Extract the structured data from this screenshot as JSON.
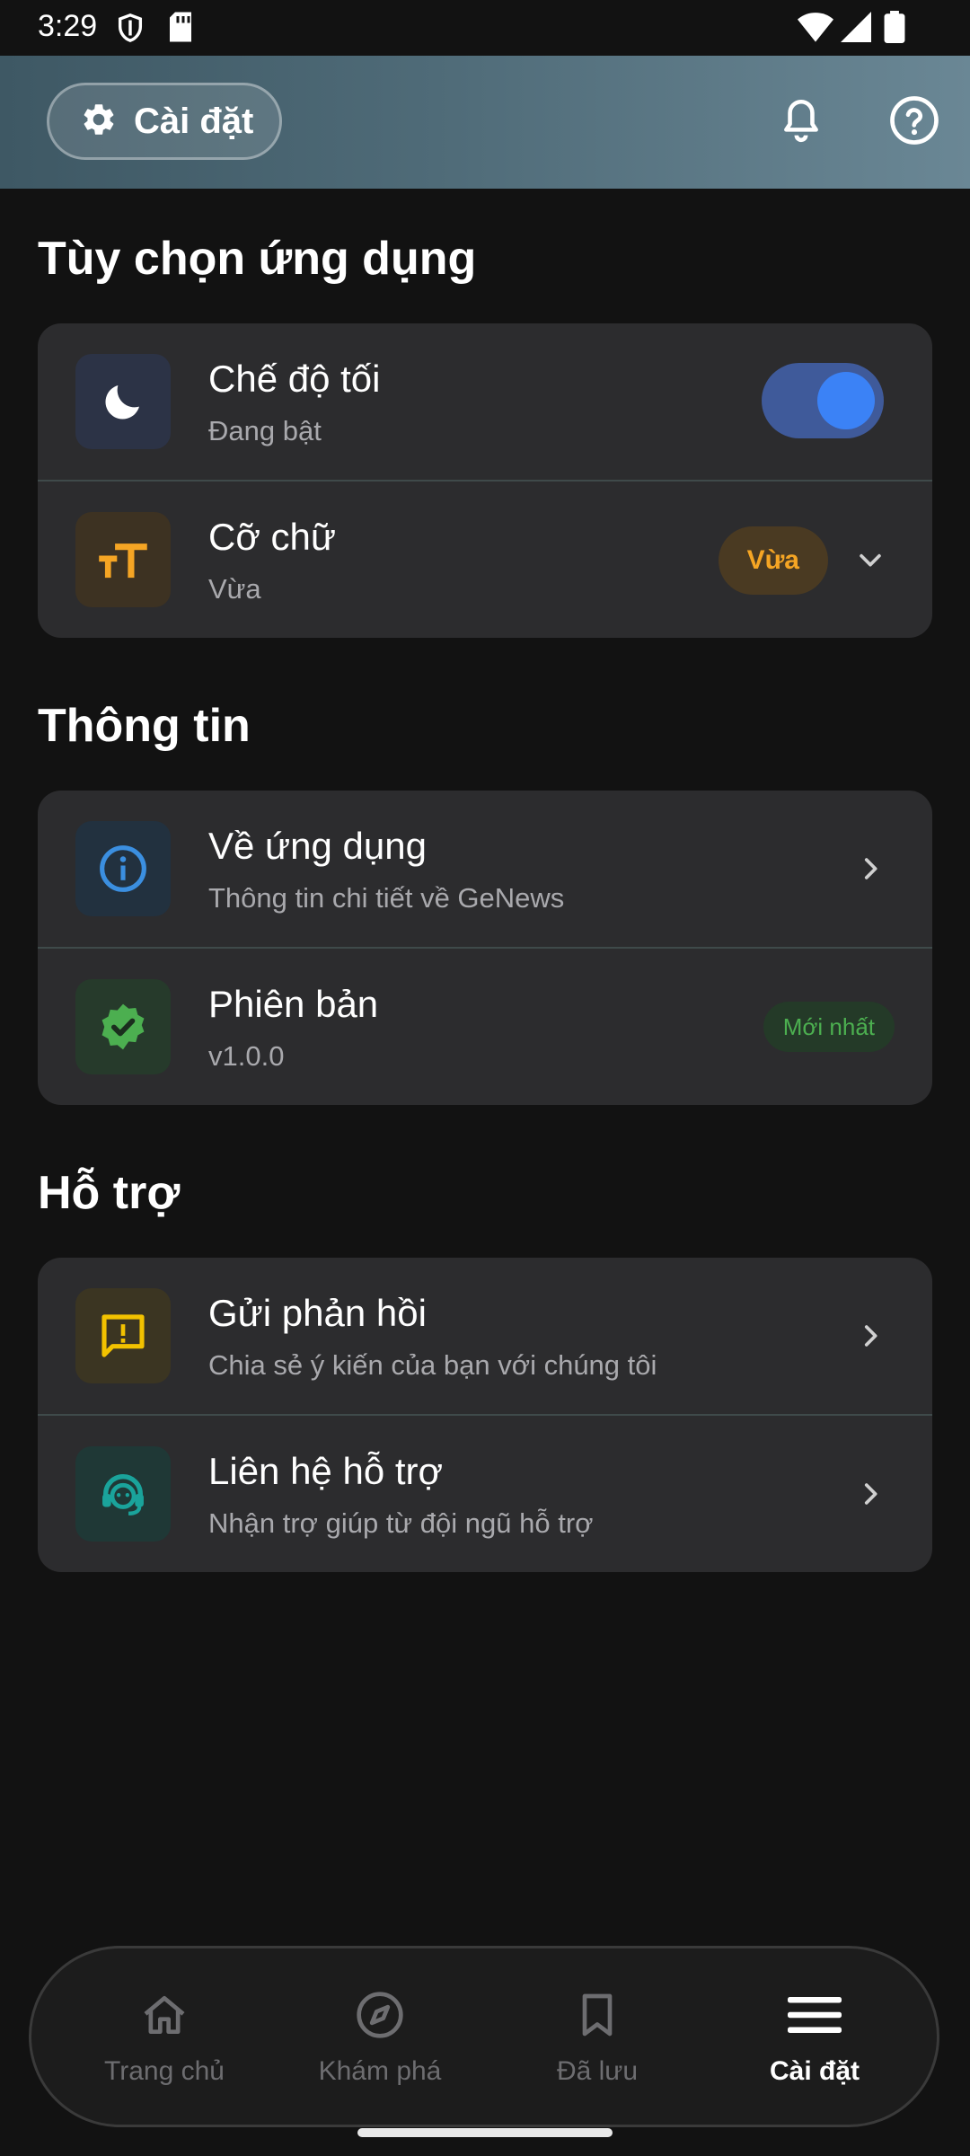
{
  "status_bar": {
    "time": "3:29"
  },
  "header": {
    "settings_label": "Cài đặt"
  },
  "sections": [
    {
      "title": "Tùy chọn ứng dụng",
      "items": [
        {
          "title": "Chế độ tối",
          "subtitle": "Đang bật",
          "icon": "moon-icon",
          "toggle_on": true
        },
        {
          "title": "Cỡ chữ",
          "subtitle": "Vừa",
          "icon": "text-size-icon",
          "badge": "Vừa"
        }
      ]
    },
    {
      "title": "Thông tin",
      "items": [
        {
          "title": "Về ứng dụng",
          "subtitle": "Thông tin chi tiết về GeNews",
          "icon": "info-icon"
        },
        {
          "title": "Phiên bản",
          "subtitle": "v1.0.0",
          "icon": "verified-icon",
          "badge": "Mới nhất"
        }
      ]
    },
    {
      "title": "Hỗ trợ",
      "items": [
        {
          "title": "Gửi phản hồi",
          "subtitle": "Chia sẻ ý kiến của bạn với chúng tôi",
          "icon": "feedback-icon"
        },
        {
          "title": "Liên hệ hỗ trợ",
          "subtitle": "Nhận trợ giúp từ đội ngũ hỗ trợ",
          "icon": "support-agent-icon"
        }
      ]
    }
  ],
  "bottom_nav": [
    {
      "label": "Trang chủ",
      "icon": "home-icon",
      "active": false
    },
    {
      "label": "Khám phá",
      "icon": "compass-icon",
      "active": false
    },
    {
      "label": "Đã lưu",
      "icon": "bookmark-icon",
      "active": false
    },
    {
      "label": "Cài đặt",
      "icon": "menu-icon",
      "active": true
    }
  ],
  "colors": {
    "accent": "#3b82f6",
    "orange": "#f5a524",
    "green": "#4caf50",
    "yellow": "#f2c200",
    "teal": "#1aa39b"
  }
}
